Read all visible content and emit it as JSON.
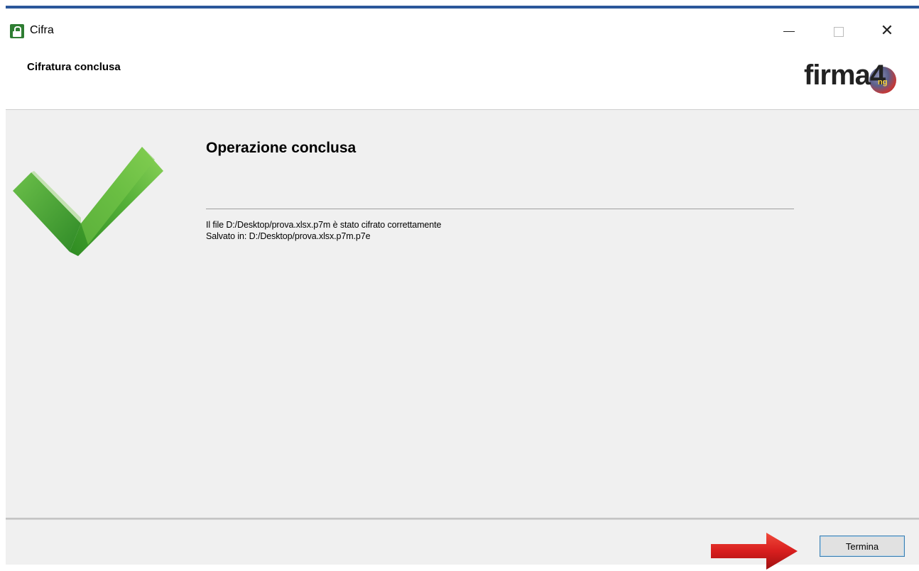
{
  "window": {
    "title": "Cifra",
    "icon": "lock-icon"
  },
  "header": {
    "title": "Cifratura conclusa",
    "logo_text": "firma4",
    "logo_suffix": "ng"
  },
  "content": {
    "title": "Operazione conclusa",
    "status_icon": "checkmark-icon",
    "messages": [
      "Il file D:/Desktop/prova.xlsx.p7m è stato cifrato correttamente",
      "Salvato in: D:/Desktop/prova.xlsx.p7m.p7e"
    ]
  },
  "footer": {
    "finish_label": "Termina",
    "pointer_icon": "red-arrow-icon"
  },
  "colors": {
    "accent_border": "#2b579a",
    "check_green": "#4caf32",
    "arrow_red": "#d81e1e"
  }
}
